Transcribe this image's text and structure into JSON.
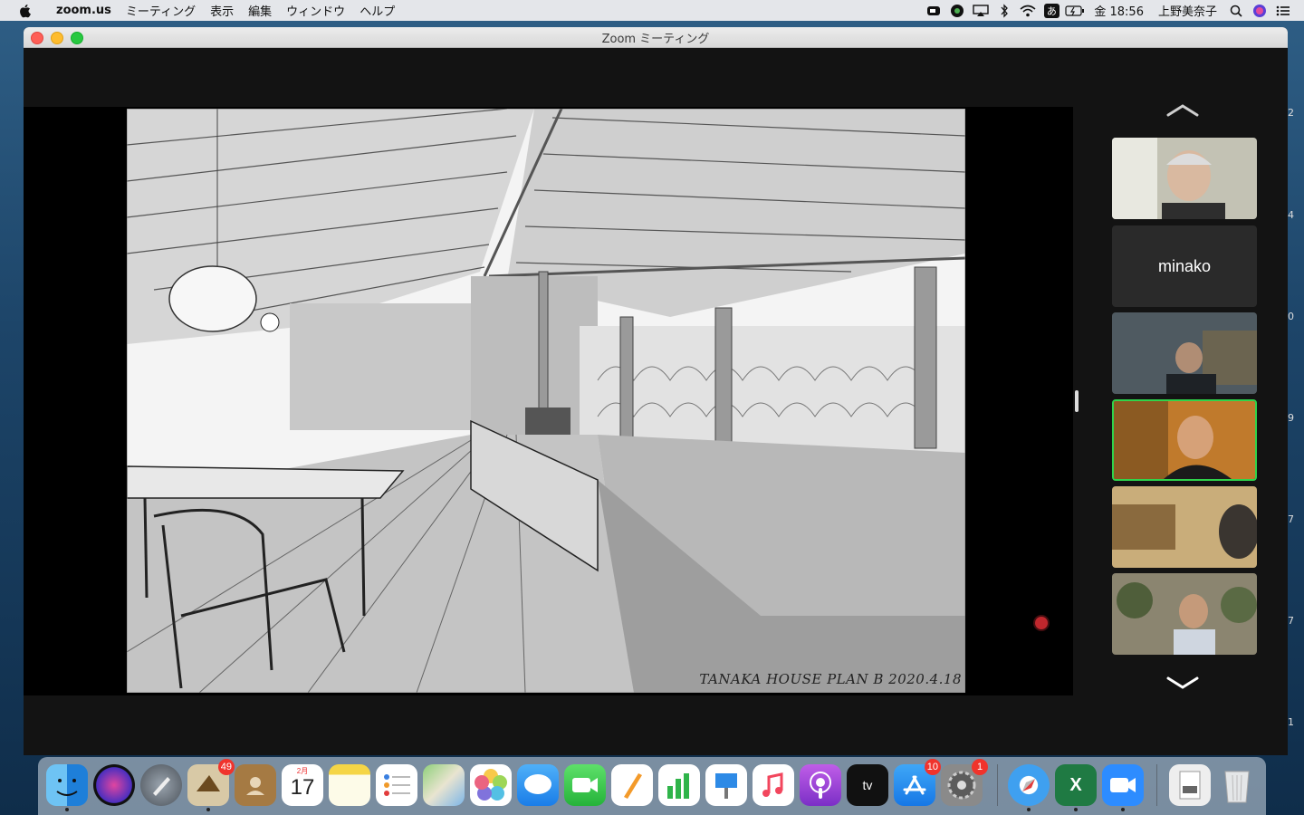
{
  "menubar": {
    "app_name": "zoom.us",
    "menus": [
      "ミーティング",
      "表示",
      "編集",
      "ウィンドウ",
      "ヘルプ"
    ],
    "clock": "金 18:56",
    "user": "上野美奈子",
    "input_method": "あ"
  },
  "window": {
    "title": "Zoom ミーティング"
  },
  "shared_screen": {
    "signature": "TANAKA HOUSE PLAN B 2020.4.18"
  },
  "participants": [
    {
      "name": "",
      "has_video": true,
      "active": false,
      "bg": "#b9b6a8"
    },
    {
      "name": "minako",
      "has_video": false,
      "active": false,
      "bg": "#2b2b2b"
    },
    {
      "name": "",
      "has_video": true,
      "active": false,
      "bg": "#5d6a72"
    },
    {
      "name": "",
      "has_video": true,
      "active": true,
      "bg": "#c47a2b"
    },
    {
      "name": "",
      "has_video": true,
      "active": false,
      "bg": "#a98e63"
    },
    {
      "name": "",
      "has_video": true,
      "active": false,
      "bg": "#8a826a"
    }
  ],
  "dock": {
    "apps": [
      {
        "name": "Finder",
        "badge": "",
        "running": true
      },
      {
        "name": "Siri",
        "badge": "",
        "running": false
      },
      {
        "name": "Launchpad",
        "badge": "",
        "running": false
      },
      {
        "name": "Mail",
        "badge": "49",
        "running": true
      },
      {
        "name": "Contacts",
        "badge": "",
        "running": false
      },
      {
        "name": "Calendar",
        "badge": "",
        "running": false
      },
      {
        "name": "Notes",
        "badge": "",
        "running": false
      },
      {
        "name": "Reminders",
        "badge": "",
        "running": false
      },
      {
        "name": "Maps",
        "badge": "",
        "running": false
      },
      {
        "name": "Photos",
        "badge": "",
        "running": false
      },
      {
        "name": "Messages",
        "badge": "",
        "running": false
      },
      {
        "name": "FaceTime",
        "badge": "",
        "running": false
      },
      {
        "name": "Pages",
        "badge": "",
        "running": false
      },
      {
        "name": "Numbers",
        "badge": "",
        "running": false
      },
      {
        "name": "Keynote",
        "badge": "",
        "running": false
      },
      {
        "name": "Music",
        "badge": "",
        "running": false
      },
      {
        "name": "Podcasts",
        "badge": "",
        "running": false
      },
      {
        "name": "TV",
        "badge": "",
        "running": false
      },
      {
        "name": "App Store",
        "badge": "10",
        "running": false
      },
      {
        "name": "System Preferences",
        "badge": "1",
        "running": false
      },
      {
        "name": "Safari",
        "badge": "",
        "running": true
      },
      {
        "name": "Excel",
        "badge": "",
        "running": true
      },
      {
        "name": "Zoom",
        "badge": "",
        "running": true
      },
      {
        "name": "Downloads",
        "badge": "",
        "running": false
      },
      {
        "name": "Trash",
        "badge": "",
        "running": false
      }
    ],
    "calendar_day": "17",
    "calendar_month": "2月"
  },
  "edge_numbers": [
    "2",
    "4",
    "0",
    "9",
    "7",
    "7",
    "1"
  ]
}
